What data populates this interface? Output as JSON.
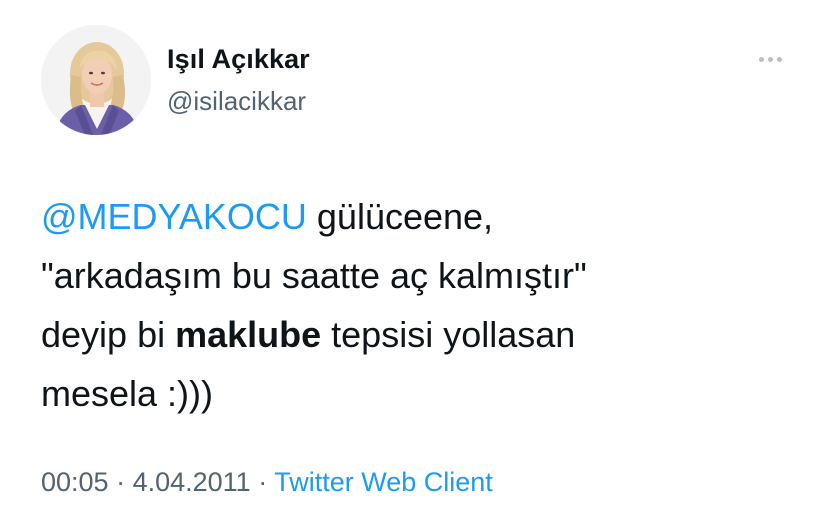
{
  "author": {
    "display_name": "Işıl Açıkkar",
    "handle": "@isilacikkar",
    "avatar_icon": "profile-photo-woman-blonde-purple-blazer"
  },
  "more_icon": "more-horizontal-icon",
  "tweet": {
    "mention": "@MEDYAKOCU",
    "line1_rest": " gülüceene,",
    "line2": "\"arkadaşım bu saatte aç kalmıştır\"",
    "line3_pre": "deyip bi ",
    "line3_bold": "maklube",
    "line3_post": " tepsisi yollasan",
    "line4": "mesela :)))"
  },
  "meta": {
    "time": "00:05",
    "sep1": " · ",
    "date": "4.04.2011",
    "sep2": " · ",
    "source": "Twitter Web Client"
  },
  "colors": {
    "link": "#1d9bf0",
    "secondary_text": "#536471",
    "primary_text": "#0f1419"
  }
}
